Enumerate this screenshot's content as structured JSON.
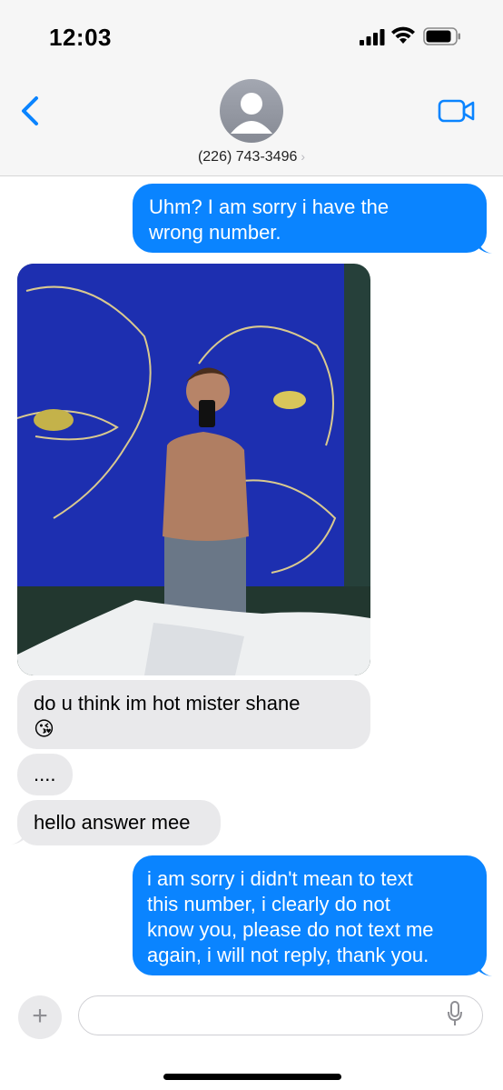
{
  "status_bar": {
    "time": "12:03"
  },
  "header": {
    "contact": "(226) 743-3496",
    "chevron": "›"
  },
  "messages": [
    {
      "from": "me",
      "text_lines": [
        "Uhm? I am sorry i have the",
        "wrong number."
      ]
    },
    {
      "from": "them",
      "type": "photo",
      "description": "shirtless mirror selfie"
    },
    {
      "from": "them",
      "text_lines": [
        "do u think im hot mister shane"
      ],
      "emoji": "😘"
    },
    {
      "from": "them",
      "text_lines": [
        "...."
      ]
    },
    {
      "from": "them",
      "text_lines": [
        "hello answer mee"
      ]
    },
    {
      "from": "me",
      "text_lines": [
        "i am sorry i didn't mean to text",
        "this number, i clearly do not",
        "know you, please do not text me",
        "again, i will not reply, thank you."
      ]
    }
  ],
  "compose": {
    "plus": "+",
    "placeholder": "",
    "value": ""
  },
  "colors": {
    "outgoing": "#0a84ff",
    "incoming": "#e9e9eb",
    "accent": "#0a84ff"
  },
  "icons": [
    "back-chevron-icon",
    "avatar-icon",
    "video-camera-icon",
    "plus-icon",
    "microphone-icon",
    "signal-icon",
    "wifi-icon",
    "battery-icon"
  ]
}
